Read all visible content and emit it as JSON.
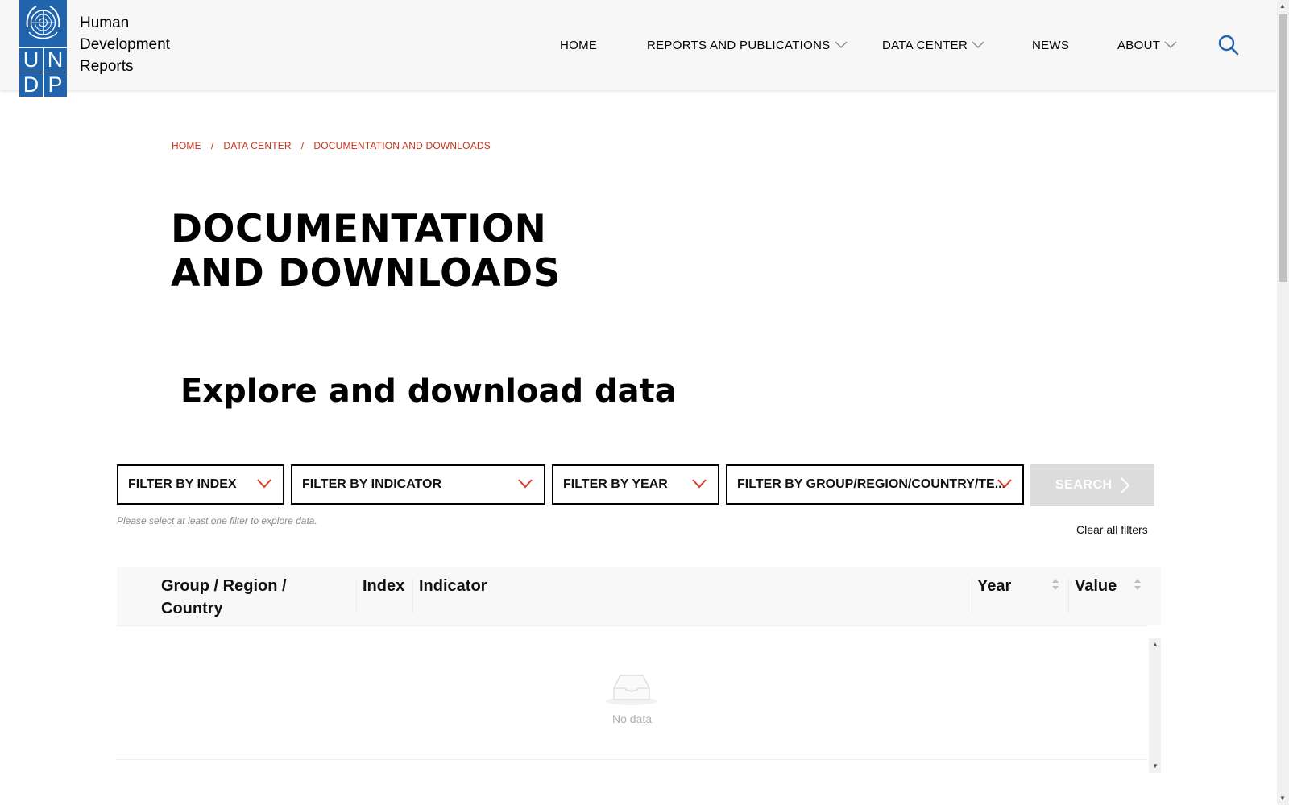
{
  "brand": {
    "logo_letters": [
      "U",
      "N",
      "D",
      "P"
    ],
    "name_lines": [
      "Human",
      "Development",
      "Reports"
    ]
  },
  "nav": {
    "items": [
      {
        "label": "HOME",
        "has_dropdown": false
      },
      {
        "label": "REPORTS AND PUBLICATIONS",
        "has_dropdown": true
      },
      {
        "label": "DATA CENTER",
        "has_dropdown": true
      },
      {
        "label": "NEWS",
        "has_dropdown": false
      },
      {
        "label": "ABOUT",
        "has_dropdown": true
      }
    ],
    "search_icon": "search-icon"
  },
  "breadcrumb": {
    "items": [
      "HOME",
      "DATA CENTER",
      "DOCUMENTATION AND DOWNLOADS"
    ],
    "separator": "/"
  },
  "page_title_lines": [
    "DOCUMENTATION",
    "AND DOWNLOADS"
  ],
  "section_title": "Explore and download data",
  "filters": [
    {
      "label": "FILTER BY INDEX"
    },
    {
      "label": "FILTER BY INDICATOR"
    },
    {
      "label": "FILTER BY YEAR"
    },
    {
      "label": "FILTER BY GROUP/REGION/COUNTRY/TE..."
    }
  ],
  "search_button": {
    "label": "SEARCH",
    "enabled": false
  },
  "hint": "Please select at least one filter to explore data.",
  "clear_filters": "Clear all filters",
  "table": {
    "columns": [
      {
        "label": "Group / Region / Country",
        "sortable": false
      },
      {
        "label": "Index",
        "sortable": false
      },
      {
        "label": "Indicator",
        "sortable": false
      },
      {
        "label": "Year",
        "sortable": true
      },
      {
        "label": "Value",
        "sortable": true
      }
    ],
    "rows": [],
    "empty_text": "No data"
  },
  "colors": {
    "undp_blue": "#1f64ad",
    "breadcrumb_red": "#c8321a",
    "chevron_red": "#d23c22",
    "disabled_button": "#dcdcdc"
  }
}
